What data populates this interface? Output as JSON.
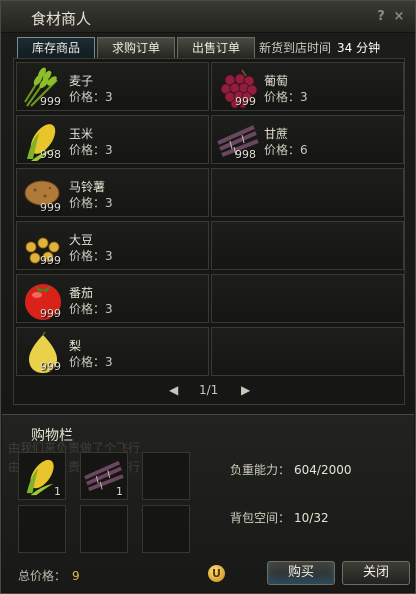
{
  "window": {
    "title": "食材商人",
    "help_label": "?",
    "close_label": "×"
  },
  "tabs": [
    {
      "label": "库存商品",
      "active": true
    },
    {
      "label": "求购订单",
      "active": false
    },
    {
      "label": "出售订单",
      "active": false
    }
  ],
  "restock": {
    "label": "新货到店时间",
    "value": "34 分钟"
  },
  "goods": [
    {
      "name": "麦子",
      "price": "价格：3",
      "qty": "999",
      "icon": "wheat-icon"
    },
    {
      "name": "葡萄",
      "price": "价格：3",
      "qty": "999",
      "icon": "grape-icon"
    },
    {
      "name": "玉米",
      "price": "价格：3",
      "qty": "998",
      "icon": "corn-icon"
    },
    {
      "name": "甘蔗",
      "price": "价格：6",
      "qty": "998",
      "icon": "sugarcane-icon"
    },
    {
      "name": "马铃薯",
      "price": "价格：3",
      "qty": "999",
      "icon": "potato-icon"
    },
    {
      "name": "大豆",
      "price": "价格：3",
      "qty": "999",
      "icon": "soybean-icon"
    },
    {
      "name": "番茄",
      "price": "价格：3",
      "qty": "999",
      "icon": "tomato-icon"
    },
    {
      "name": "梨",
      "price": "价格：3",
      "qty": "999",
      "icon": "pear-icon"
    }
  ],
  "pager": {
    "prev": "◀",
    "page": "1/1",
    "next": "▶"
  },
  "cart": {
    "title": "购物栏",
    "items": [
      {
        "qty": "1",
        "icon": "corn-icon"
      },
      {
        "qty": "1",
        "icon": "sugarcane-icon"
      }
    ],
    "capacity_label": "负重能力：",
    "capacity_value": "604/2000",
    "bag_label": "背包空间：",
    "bag_value": "10/32",
    "total_label": "总价格：",
    "total_value": "9",
    "coin_symbol": "U",
    "ghost_lines": [
      "由我们来负责做了个飞行",
      "由我们来负责做了个飞行"
    ]
  },
  "buttons": {
    "buy": "购买",
    "close": "关闭"
  },
  "colors": {
    "gold": "#e0b94a",
    "accent_tab": "#101c21"
  }
}
